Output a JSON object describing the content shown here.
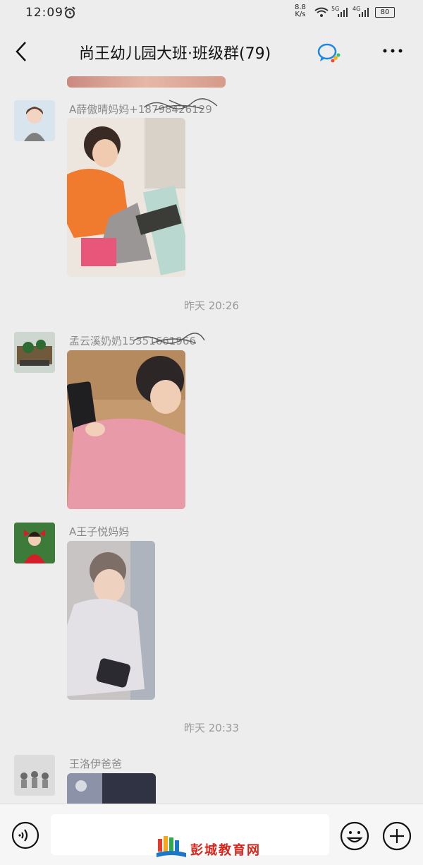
{
  "status": {
    "time": "12:09",
    "net_speed": "8.8",
    "net_unit": "K/s",
    "sig1": "5G",
    "sig2": "4G",
    "battery": "80"
  },
  "header": {
    "title": "尚王幼儿园大班·班级群(79)"
  },
  "timestamps": [
    "昨天 20:26",
    "昨天 20:33"
  ],
  "messages": [
    {
      "sender": "A薛傲晴妈妈+18798426129"
    },
    {
      "sender": "孟云溪奶奶15351661966"
    },
    {
      "sender": "A王子悦妈妈"
    },
    {
      "sender": "王洛伊爸爸"
    }
  ],
  "watermark": {
    "text": "彭城教育网"
  },
  "icons": [
    "back-arrow-icon",
    "group-chat-icon",
    "more-icon",
    "voice-icon",
    "emoji-icon",
    "plus-icon",
    "alarm-icon",
    "wifi-icon",
    "signal-icon"
  ],
  "colors": {
    "background": "#ededed",
    "input_bar": "#f6f6f6",
    "watermark": "#d9261c"
  }
}
